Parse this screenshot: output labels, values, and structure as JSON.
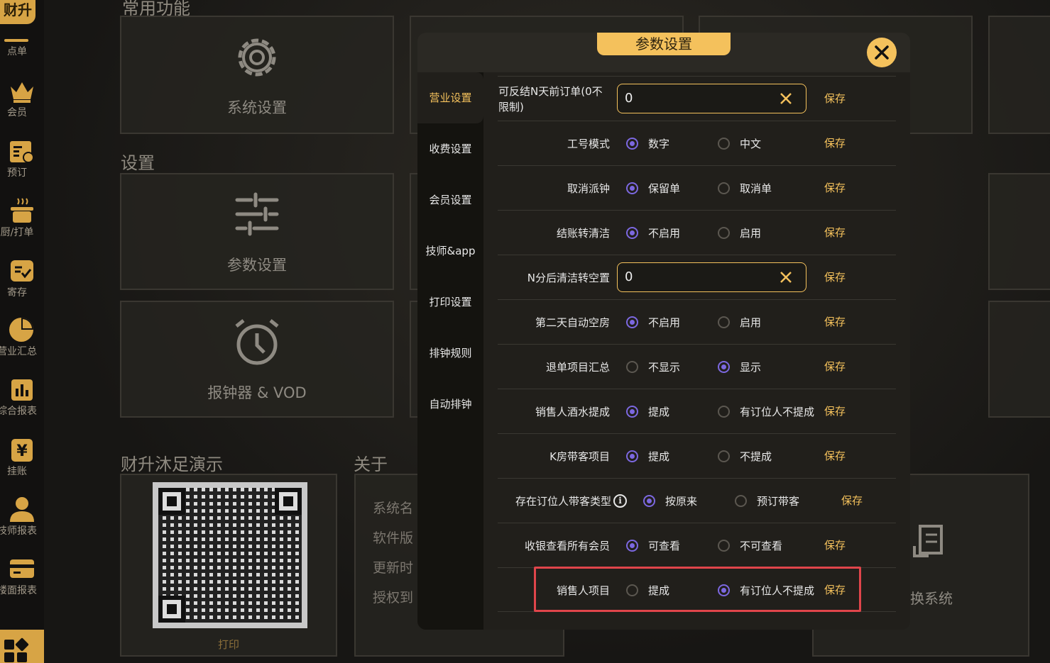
{
  "sidebar": {
    "brand": "财升",
    "items": [
      {
        "label": "点单",
        "icon": "order-icon"
      },
      {
        "label": "会员",
        "icon": "crown-icon"
      },
      {
        "label": "预订",
        "icon": "calendar-icon"
      },
      {
        "label": "厨/打单",
        "icon": "kitchen-pot-icon"
      },
      {
        "label": "寄存",
        "icon": "storage-icon"
      },
      {
        "label": "营业汇总",
        "icon": "pie-chart-icon"
      },
      {
        "label": "综合报表",
        "icon": "bar-report-icon"
      },
      {
        "label": "挂账",
        "icon": "yen-icon"
      },
      {
        "label": "技师报表",
        "icon": "person-icon"
      },
      {
        "label": "楼面报表",
        "icon": "card-icon"
      }
    ]
  },
  "main": {
    "common_title": "常用功能",
    "settings_title": "设置",
    "cards": {
      "system": "系统设置",
      "params": "参数设置",
      "alarm": "报钟器 & VOD"
    },
    "demo_title": "财升沐足演示",
    "print_label": "打印",
    "about_title": "关于",
    "about_lines": [
      "系统名",
      "软件版",
      "更新时",
      "授权到"
    ],
    "switch_system": "换系统"
  },
  "modal": {
    "title": "参数设置",
    "tabs": [
      "营业设置",
      "收费设置",
      "会员设置",
      "技师&app",
      "打印设置",
      "排钟规则",
      "自动排钟"
    ],
    "save_label": "保存",
    "rows": [
      {
        "label": "可反结N天前订单(0不限制)",
        "type": "input",
        "value": "0"
      },
      {
        "label": "工号模式",
        "type": "radio",
        "options": [
          "数字",
          "中文"
        ],
        "selected": 0
      },
      {
        "label": "取消派钟",
        "type": "radio",
        "options": [
          "保留单",
          "取消单"
        ],
        "selected": 0
      },
      {
        "label": "结账转清洁",
        "type": "radio",
        "options": [
          "不启用",
          "启用"
        ],
        "selected": 0
      },
      {
        "label": "N分后清洁转空置",
        "type": "input",
        "value": "0"
      },
      {
        "label": "第二天自动空房",
        "type": "radio",
        "options": [
          "不启用",
          "启用"
        ],
        "selected": 0
      },
      {
        "label": "退单项目汇总",
        "type": "radio",
        "options": [
          "不显示",
          "显示"
        ],
        "selected": 1
      },
      {
        "label": "销售人酒水提成",
        "type": "radio",
        "options": [
          "提成",
          "有订位人不提成"
        ],
        "selected": 0
      },
      {
        "label": "K房带客项目",
        "type": "radio",
        "options": [
          "提成",
          "不提成"
        ],
        "selected": 0
      },
      {
        "label": "存在订位人带客类型",
        "type": "radio",
        "options": [
          "按原来",
          "预订带客"
        ],
        "selected": 0,
        "info": true
      },
      {
        "label": "收银查看所有会员",
        "type": "radio",
        "options": [
          "可查看",
          "不可查看"
        ],
        "selected": 0
      },
      {
        "label": "销售人项目",
        "type": "radio",
        "options": [
          "提成",
          "有订位人不提成"
        ],
        "selected": 1
      }
    ]
  },
  "colors": {
    "accent": "#f4c15c",
    "radio": "#7c68e0",
    "highlight": "#e0454b"
  }
}
